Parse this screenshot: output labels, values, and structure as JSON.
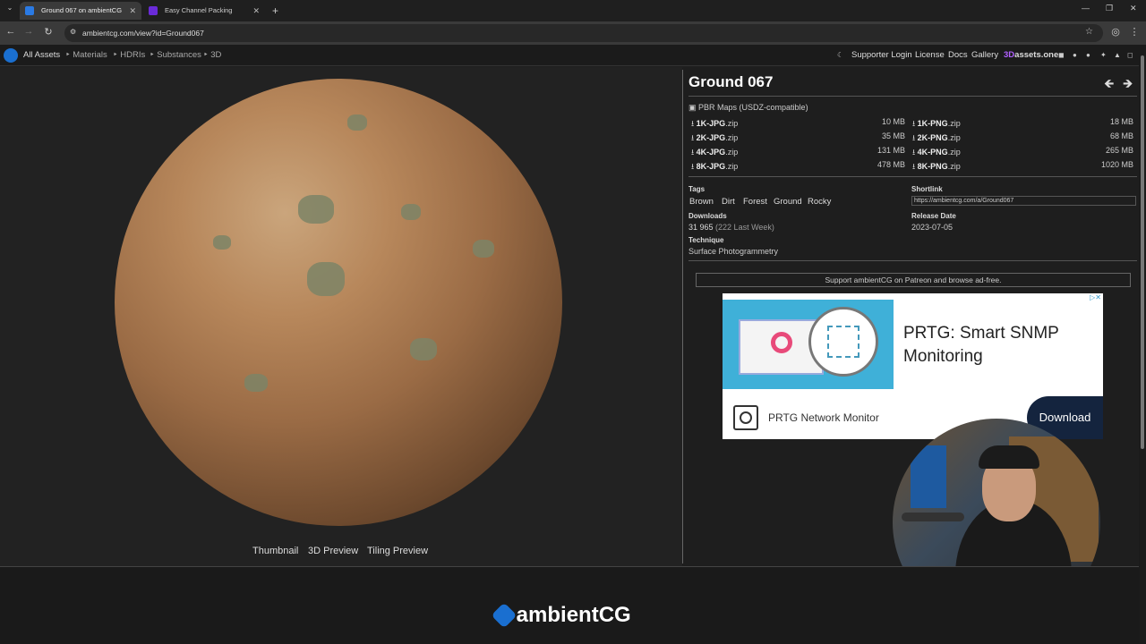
{
  "browser": {
    "tabs": [
      {
        "label": "Ground 067 on ambientCG",
        "active": true
      },
      {
        "label": "Easy Channel Packing",
        "active": false
      }
    ],
    "new_tab": "+",
    "url": "ambientcg.com/view?id=Ground067"
  },
  "nav": {
    "brand": "All Assets",
    "left_links": [
      "Materials",
      "HDRIs",
      "Substances",
      "3D"
    ],
    "right_links": [
      "Supporter Login",
      "License",
      "Docs",
      "Gallery"
    ],
    "partner_prefix": "3D",
    "partner_suffix": "assets.one"
  },
  "asset": {
    "title": "Ground 067",
    "maps_heading": "PBR Maps (USDZ-compatible)",
    "downloads_jpg": [
      {
        "name": "1K-JPG",
        "ext": ".zip",
        "size": "10 MB"
      },
      {
        "name": "2K-JPG",
        "ext": ".zip",
        "size": "35 MB"
      },
      {
        "name": "4K-JPG",
        "ext": ".zip",
        "size": "131 MB"
      },
      {
        "name": "8K-JPG",
        "ext": ".zip",
        "size": "478 MB"
      }
    ],
    "downloads_png": [
      {
        "name": "1K-PNG",
        "ext": ".zip",
        "size": "18 MB"
      },
      {
        "name": "2K-PNG",
        "ext": ".zip",
        "size": "68 MB"
      },
      {
        "name": "4K-PNG",
        "ext": ".zip",
        "size": "265 MB"
      },
      {
        "name": "8K-PNG",
        "ext": ".zip",
        "size": "1020 MB"
      }
    ],
    "tags_label": "Tags",
    "tags": [
      "Brown",
      "Dirt",
      "Forest",
      "Ground",
      "Rocky"
    ],
    "shortlink_label": "Shortlink",
    "shortlink": "https://ambientcg.com/a/Ground067",
    "downloads_label": "Downloads",
    "downloads_count": "31 965",
    "downloads_week": "(222 Last Week)",
    "release_label": "Release Date",
    "release_date": "2023-07-05",
    "technique_label": "Technique",
    "technique": "Surface Photogrammetry"
  },
  "preview_links": [
    "Thumbnail",
    "3D Preview",
    "Tiling Preview"
  ],
  "support_text": "Support ambientCG on Patreon and browse ad-free.",
  "ad": {
    "headline": "PRTG: Smart SNMP Monitoring",
    "brand": "PRTG Network Monitor",
    "cta": "Download"
  },
  "footer": {
    "logo": "ambientCG"
  }
}
